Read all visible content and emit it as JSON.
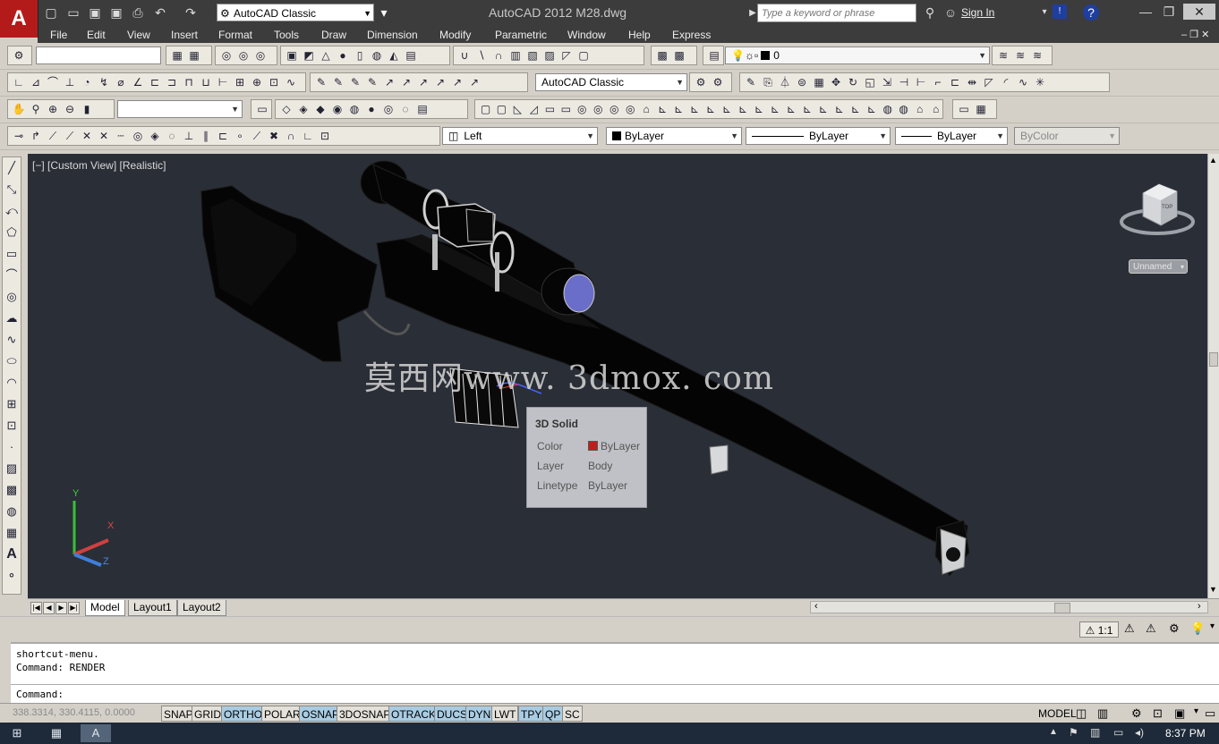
{
  "titlebar": {
    "app_button": "A",
    "workspace": "AutoCAD Classic",
    "title": "AutoCAD 2012    M28.dwg",
    "search_placeholder": "Type a keyword or phrase",
    "sign_in": "Sign In",
    "help": "?"
  },
  "menu": [
    "File",
    "Edit",
    "View",
    "Insert",
    "Format",
    "Tools",
    "Draw",
    "Dimension",
    "Modify",
    "Parametric",
    "Window",
    "Help",
    "Express"
  ],
  "toolbar": {
    "layer_value": "0",
    "dimstyle": "AutoCAD Classic",
    "view_name": "Left",
    "color": "ByLayer",
    "linetype": "ByLayer",
    "lineweight": "ByLayer",
    "plotstyle": "ByColor"
  },
  "viewport": {
    "label": "[−] [Custom View] [Realistic]",
    "watermark": "莫西网www. 3dmox. com",
    "viewcube_face": "TOP",
    "named_ucs": "Unnamed",
    "ucs_y": "Y",
    "ucs_x": "X",
    "ucs_z": "Z"
  },
  "tooltip": {
    "title": "3D Solid",
    "rows": [
      {
        "key": "Color",
        "value": "ByLayer"
      },
      {
        "key": "Layer",
        "value": "Body"
      },
      {
        "key": "Linetype",
        "value": "ByLayer"
      }
    ],
    "color_swatch": "#c31b1b"
  },
  "layout_tabs": [
    "Model",
    "Layout1",
    "Layout2"
  ],
  "annotation": {
    "scale": "1:1"
  },
  "command": {
    "line1": "shortcut-menu.",
    "line2": "Command: RENDER",
    "prompt": "Command:"
  },
  "status": {
    "coords": "338.3314, 330.4115, 0.0000",
    "buttons": [
      {
        "label": "SNAP",
        "on": false
      },
      {
        "label": "GRID",
        "on": false
      },
      {
        "label": "ORTHO",
        "on": true
      },
      {
        "label": "POLAR",
        "on": false
      },
      {
        "label": "OSNAP",
        "on": true
      },
      {
        "label": "3DOSNAP",
        "on": false
      },
      {
        "label": "OTRACK",
        "on": true
      },
      {
        "label": "DUCS",
        "on": true
      },
      {
        "label": "DYN",
        "on": true
      },
      {
        "label": "LWT",
        "on": false
      },
      {
        "label": "TPY",
        "on": true
      },
      {
        "label": "QP",
        "on": true
      },
      {
        "label": "SC",
        "on": false
      }
    ],
    "model": "MODEL"
  },
  "taskbar": {
    "clock": "8:37 PM"
  },
  "colors": {
    "accent": "#b31b1b",
    "viewport_bg": "#2a2e36",
    "status_on": "#a9cce3"
  }
}
